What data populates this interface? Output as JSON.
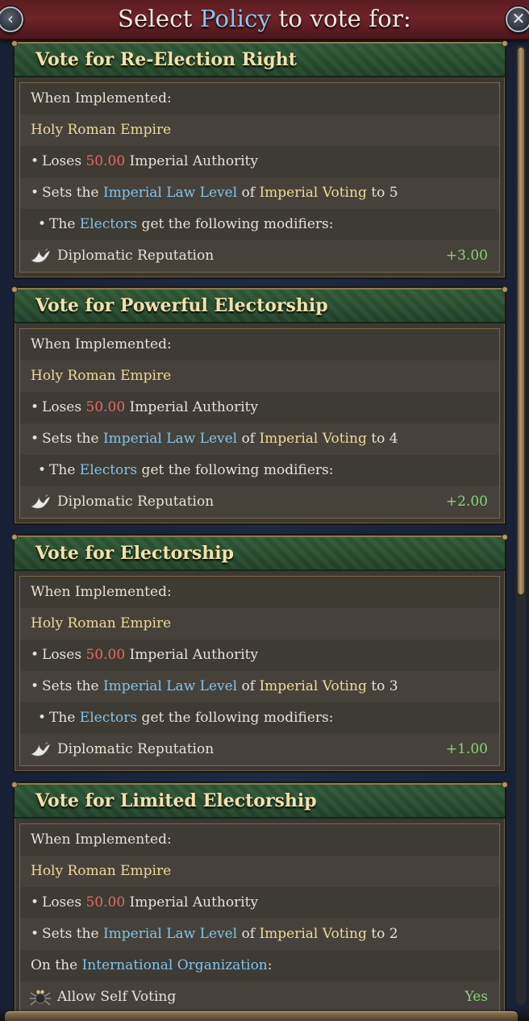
{
  "header": {
    "title_prefix": "Select ",
    "title_highlight": "Policy",
    "title_suffix": " to vote for:",
    "back_glyph": "‹",
    "close_glyph": "✕"
  },
  "common": {
    "when_implemented": "When Implemented:",
    "country": "Holy Roman Empire",
    "loses_prefix": "Loses ",
    "loses_amount": "50.00",
    "loses_suffix": " Imperial Authority",
    "sets_prefix": "Sets the ",
    "sets_law": "Imperial Law Level",
    "sets_mid": " of ",
    "sets_target": "Imperial Voting",
    "electors_prefix": "The ",
    "electors_name": "Electors",
    "electors_suffix": " get the following modifiers:",
    "modifier_name": "Diplomatic Reputation"
  },
  "cards": [
    {
      "title": "Vote for Re-Election Right",
      "sets_to": " to 5",
      "modifier_value": "+3.00"
    },
    {
      "title": "Vote for Powerful Electorship",
      "sets_to": " to 4",
      "modifier_value": "+2.00"
    },
    {
      "title": "Vote for Electorship",
      "sets_to": " to 3",
      "modifier_value": "+1.00"
    },
    {
      "title": "Vote for Limited Electorship",
      "sets_to": " to 2",
      "org_prefix": "On the ",
      "org_name": "International Organization",
      "org_suffix": ":",
      "self_voting_label": "Allow Self Voting",
      "self_voting_value": "Yes"
    }
  ],
  "icons": {
    "modifier": "dove-icon",
    "self_voting": "spider-icon",
    "back": "chevron-left-icon",
    "close": "close-icon"
  },
  "colors": {
    "title_highlight": "#8fc4ee",
    "link_blue": "#84c2ea",
    "value_yellow": "#efd99a",
    "negative_red": "#e46a63",
    "positive_green": "#8ad27a",
    "header_green": "#2a4f30",
    "titlebar_red": "#6e2328"
  }
}
